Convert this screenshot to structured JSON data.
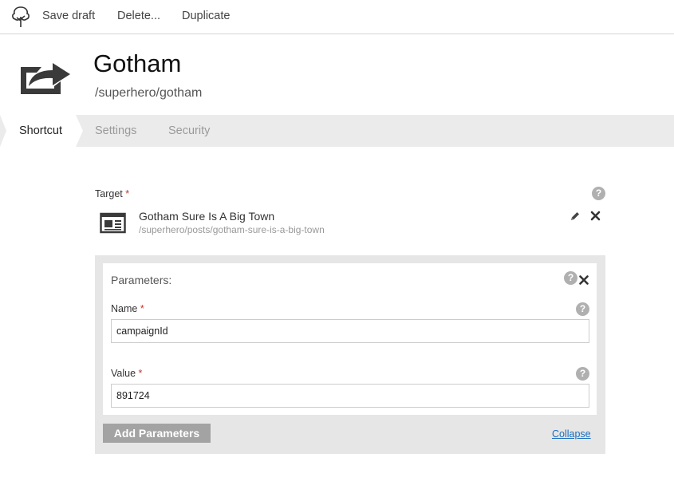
{
  "toolbar": {
    "logo_icon": "tree-logo-icon",
    "save_label": "Save draft",
    "delete_label": "Delete...",
    "duplicate_label": "Duplicate"
  },
  "header": {
    "icon": "shortcut-share-icon",
    "title": "Gotham",
    "path": "/superhero/gotham"
  },
  "tabs": [
    {
      "label": "Shortcut",
      "active": true
    },
    {
      "label": "Settings",
      "active": false
    },
    {
      "label": "Security",
      "active": false
    }
  ],
  "target": {
    "label": "Target",
    "required_marker": "*",
    "help_glyph": "?",
    "item_title": "Gotham Sure Is A Big Town",
    "item_path": "/superhero/posts/gotham-sure-is-a-big-town",
    "item_icon": "article-icon"
  },
  "parameters": {
    "title": "Parameters:",
    "help_glyph": "?",
    "name_label": "Name",
    "name_value": "campaignId",
    "value_label": "Value",
    "value_value": "891724",
    "required_marker": "*",
    "add_label": "Add Parameters",
    "collapse_label": "Collapse"
  },
  "colors": {
    "tab_bar": "#ebebeb",
    "required": "#c0392b",
    "link": "#1a6dbe",
    "button": "#a3a3a3",
    "icon_dark": "#3a3a3a"
  }
}
